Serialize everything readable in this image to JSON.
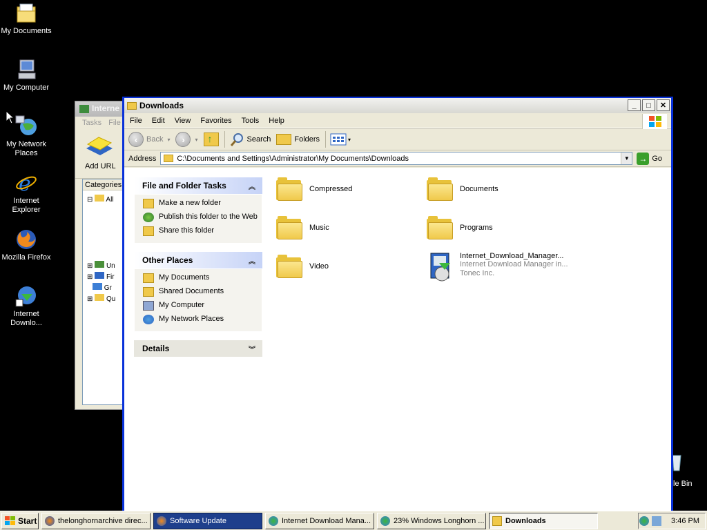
{
  "desktop": {
    "icons": [
      {
        "label": "My Documents",
        "icon": "my-documents-icon"
      },
      {
        "label": "My Computer",
        "icon": "my-computer-icon"
      },
      {
        "label": "My Network Places",
        "icon": "network-places-icon"
      },
      {
        "label": "Internet Explorer",
        "icon": "internet-explorer-icon"
      },
      {
        "label": "Mozilla Firefox",
        "icon": "firefox-icon"
      },
      {
        "label": "Internet Downlo...",
        "icon": "idm-icon"
      }
    ],
    "recycle_label": "le Bin"
  },
  "idm_window": {
    "title": "Interne",
    "menu": [
      "Tasks",
      "File"
    ],
    "add_url": "Add URL",
    "categories_header": "Categories",
    "tree": [
      "All",
      "Un",
      "Fir",
      "Gr",
      "Qu"
    ]
  },
  "window": {
    "title": "Downloads",
    "menu": [
      "File",
      "Edit",
      "View",
      "Favorites",
      "Tools",
      "Help"
    ],
    "toolbar": {
      "back": "Back",
      "search": "Search",
      "folders": "Folders"
    },
    "address_label": "Address",
    "address": "C:\\Documents and Settings\\Administrator\\My Documents\\Downloads",
    "go": "Go"
  },
  "taskpane": {
    "file_tasks": {
      "title": "File and Folder Tasks",
      "items": [
        "Make a new folder",
        "Publish this folder to the Web",
        "Share this folder"
      ]
    },
    "other_places": {
      "title": "Other Places",
      "items": [
        "My Documents",
        "Shared Documents",
        "My Computer",
        "My Network Places"
      ]
    },
    "details": {
      "title": "Details"
    }
  },
  "files": [
    {
      "name": "Compressed",
      "type": "folder"
    },
    {
      "name": "Documents",
      "type": "folder"
    },
    {
      "name": "Music",
      "type": "folder"
    },
    {
      "name": "Programs",
      "type": "folder"
    },
    {
      "name": "Video",
      "type": "folder"
    },
    {
      "name": "Internet_Download_Manager...",
      "desc": "Internet Download Manager in...",
      "company": "Tonec Inc.",
      "type": "installer"
    }
  ],
  "taskbar": {
    "start": "Start",
    "tasks": [
      "thelonghornarchive direc...",
      "Software Update",
      "Internet Download Mana...",
      "23% Windows Longhorn ...",
      "Downloads"
    ],
    "clock": "3:46 PM"
  },
  "colors": {
    "title_active": "#0831d9",
    "taskbar": "#ece9d8",
    "folder": "#f0c94a"
  }
}
